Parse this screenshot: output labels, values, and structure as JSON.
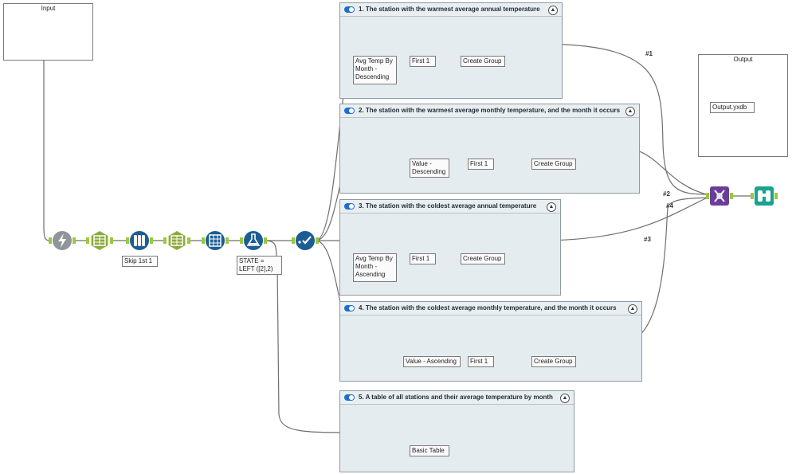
{
  "canvas": {
    "colors": {
      "wire": "#6f6f6f",
      "anchor": "#9bc83c",
      "container_bg": "#e5ecef",
      "tool_blue": "#1c5d94",
      "tool_teal": "#19a391",
      "tool_green": "#8caa3c",
      "tool_gray": "#8f969b",
      "tool_red": "#e04b3a",
      "tool_orange": "#e5a048",
      "tool_purple": "#6a3d9b"
    }
  },
  "input_box": {
    "title": "Input"
  },
  "output_box": {
    "title": "Output"
  },
  "containers": [
    {
      "id": "c1",
      "title": "1. The station with the warmest average annual temperature",
      "enabled": true
    },
    {
      "id": "c2",
      "title": "2. The station with the warmest average monthly temperature, and the month it occurs",
      "enabled": true
    },
    {
      "id": "c3",
      "title": "3. The station with the coldest average annual temperature",
      "enabled": true
    },
    {
      "id": "c4",
      "title": "4. The station with the coldest average monthly temperature, and the month it occurs",
      "enabled": true
    },
    {
      "id": "c5",
      "title": "5. A table of all stations and their average temperature by month",
      "enabled": true
    }
  ],
  "tool_labels": {
    "main_skip": "Skip 1st 1",
    "main_formula": "STATE = LEFT ([2],2)",
    "c1_sort": "Avg Temp By Month - Descending",
    "c1_first": "First 1",
    "c1_group": "Create Group",
    "c2_sort": "Value - Descending",
    "c2_first": "First 1",
    "c2_group": "Create Group",
    "c3_sort": "Avg Temp By Month - Ascending",
    "c3_first": "First 1",
    "c3_group": "Create Group",
    "c4_sort": "Value - Ascending",
    "c4_first": "First 1",
    "c4_group": "Create Group",
    "c5_table": "Basic Table",
    "output_file": "Output.yxdb"
  },
  "wire_labels": [
    "#1",
    "#2",
    "#3",
    "#4"
  ],
  "tool_icons": {
    "input_data": "book-icon",
    "browse": "binoculars-icon",
    "auto_field": "lightning-icon",
    "text_to_columns": "columns-icon",
    "sample": "sample-icon",
    "cross_tab": "crosstab-icon",
    "formula": "flask-icon",
    "select": "check-icon",
    "sort": "dots-icon",
    "transpose": "transpose-icon",
    "union": "union-icon",
    "table": "table-icon"
  }
}
